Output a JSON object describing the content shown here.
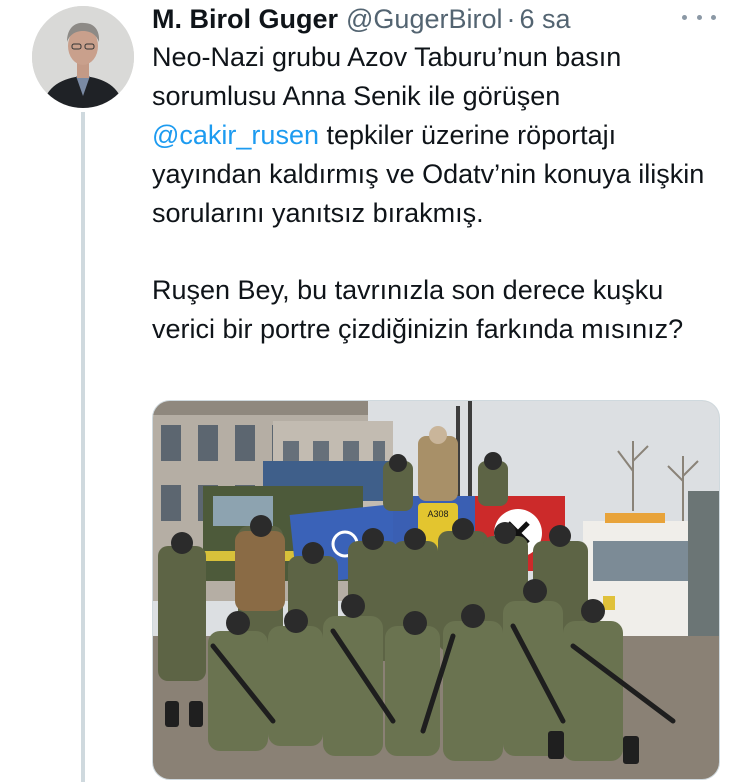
{
  "tweet": {
    "author": {
      "name": "M. Birol Guger",
      "handle": "@GugerBirol",
      "separator": "·",
      "time": "6 sa",
      "avatar_icon": "profile-photo"
    },
    "more_icon": "ellipsis-icon",
    "text": {
      "p1_before": "Neo-Nazi grubu Azov Taburu’nun basın sorumlusu Anna Senik ile görüşen ",
      "mention": "@cakir_rusen",
      "p1_after": " tepkiler üzerine röportajı yayından kaldırmış ve Odatv’nin konuya ilişkin sorularını yanıtsız bırakmış.",
      "p2": "Ruşen Bey, bu tavrınızla son derece kuşku verici bir portre çizdiğinizin farkında mısınız?"
    },
    "media": {
      "description_icon": "photo-soldiers-with-flags",
      "flag_label": "A308"
    },
    "colors": {
      "mention": "#1d9bf0",
      "text": "#0f1419",
      "secondary": "#536471",
      "thread_line": "#cfd9de"
    }
  }
}
